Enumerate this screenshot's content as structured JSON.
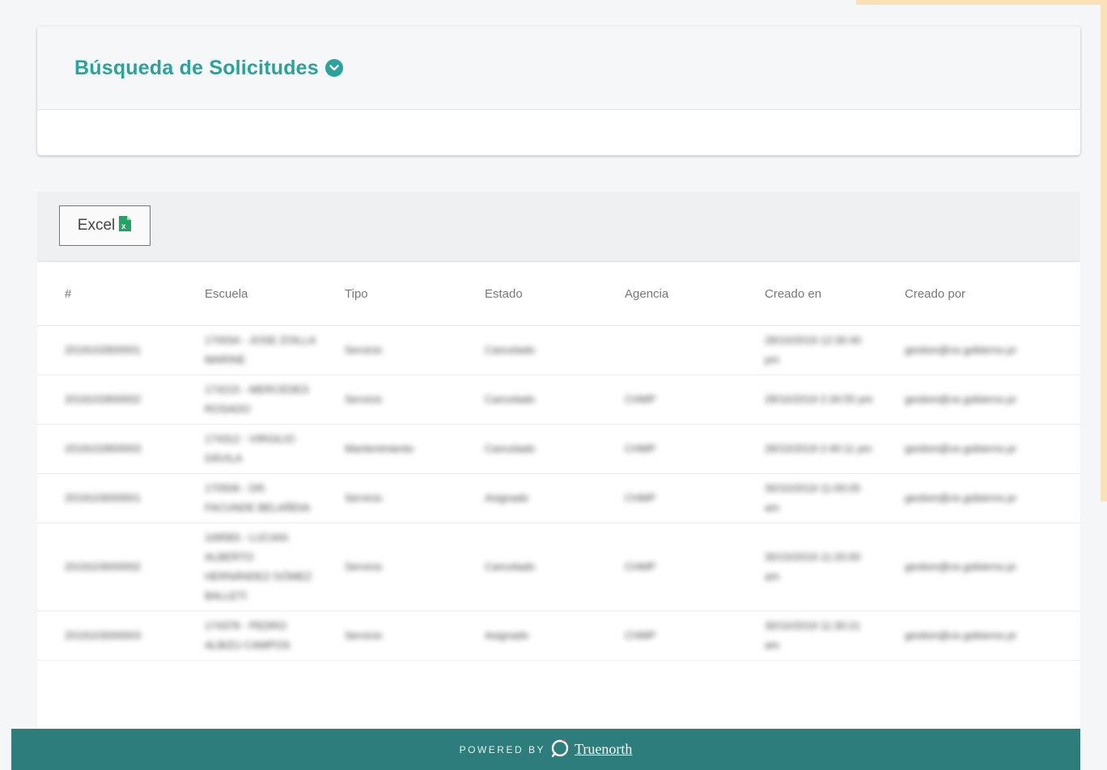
{
  "search": {
    "title": "Búsqueda de Solicitudes"
  },
  "toolbar": {
    "excel_label": "Excel"
  },
  "table": {
    "columns": [
      "#",
      "Escuela",
      "Tipo",
      "Estado",
      "Agencia",
      "Creado en",
      "Creado por"
    ],
    "rows": [
      [
        "2019102800001",
        "170034 - JOSE ZOILLA MARINE",
        "Servicio",
        "Cancelado",
        "",
        "28/10/2019 12:30:40 pm",
        "gestion@ce.gobierno.pr"
      ],
      [
        "2019102800002",
        "174215 - MERCEDES ROSADO",
        "Servicio",
        "Cancelado",
        "CHMP",
        "28/10/2019 2:34:55 pm",
        "gestion@ce.gobierno.pr"
      ],
      [
        "2019102800003",
        "174312 - VIRGILIO DÁVILA",
        "Mantenimiento",
        "Cancelado",
        "CHMP",
        "28/10/2019 2:40:11 pm",
        "gestion@ce.gobierno.pr"
      ],
      [
        "2019103000001",
        "170506 - DR. FACUNDE BELAÑDIA",
        "Servicio",
        "Asignado",
        "CHMP",
        "30/10/2019 11:00:05 am",
        "gestion@ce.gobierno.pr"
      ],
      [
        "2019103000002",
        "169583 - LUCIAN ALBERTO HERNÁNDEZ GÓMEZ BALLETI",
        "Servicio",
        "Cancelado",
        "CHMP",
        "30/10/2019 11:20:00 am",
        "gestion@ce.gobierno.pr"
      ],
      [
        "2019103000003",
        "174378 - PEDRO ALBIZU CAMPOS",
        "Servicio",
        "Asignado",
        "CHMP",
        "30/10/2019 11:30:21 am",
        "gestion@ce.gobierno.pr"
      ]
    ]
  },
  "footer": {
    "powered_by": "POWERED BY",
    "brand": "Truenorth"
  },
  "colors": {
    "accent": "#2aa39c",
    "footer": "#2c7d7b",
    "excel_green": "#21a366",
    "deco": "#fbe1b8"
  },
  "icons": {
    "title_toggle": "chevron-down-circle-icon",
    "excel": "excel-file-icon",
    "brand": "truenorth-logo-icon"
  }
}
